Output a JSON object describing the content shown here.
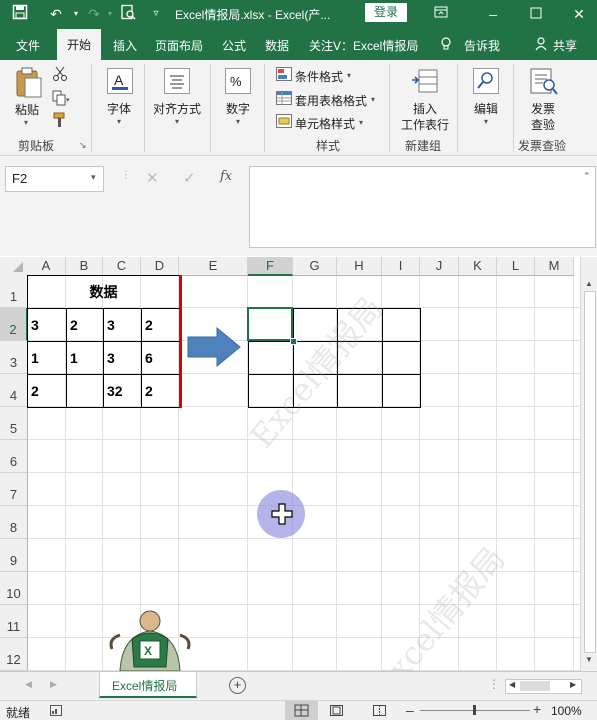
{
  "titlebar": {
    "title": "Excel情报局.xlsx  -  Excel(产...",
    "login_label": "登录"
  },
  "tabs": [
    {
      "label": "文件"
    },
    {
      "label": "开始"
    },
    {
      "label": "插入"
    },
    {
      "label": "页面布局"
    },
    {
      "label": "公式"
    },
    {
      "label": "数据"
    },
    {
      "label": "关注V：Excel情报局"
    },
    {
      "label": "告诉我"
    },
    {
      "label": "共享"
    }
  ],
  "ribbon": {
    "paste_label": "粘贴",
    "clipboard_group": "剪贴板",
    "font_label": "字体",
    "align_label": "对齐方式",
    "number_label": "数字",
    "cond_format_label": "条件格式",
    "table_format_label": "套用表格格式",
    "cell_style_label": "单元格样式",
    "styles_group": "样式",
    "insert_row_line1": "插入",
    "insert_row_line2": "工作表行",
    "newgroup_label": "新建组",
    "edit_label": "编辑",
    "invoice_line1": "发票",
    "invoice_line2": "查验",
    "invoice_group": "发票查验"
  },
  "formula_bar": {
    "name_box": "F2",
    "fx_symbol": "fx",
    "formula_value": ""
  },
  "columns": [
    "A",
    "B",
    "C",
    "D",
    "E",
    "F",
    "G",
    "H",
    "I",
    "J",
    "K",
    "L",
    "M"
  ],
  "rows": [
    "1",
    "2",
    "3",
    "4",
    "5",
    "6",
    "7",
    "8",
    "9",
    "10",
    "11",
    "12"
  ],
  "table": {
    "header": "数据",
    "values": [
      [
        "3",
        "2",
        "3",
        "2"
      ],
      [
        "1",
        "1",
        "3",
        "6"
      ],
      [
        "2",
        "",
        "32",
        "2"
      ]
    ]
  },
  "watermark_text": "Excel情报局",
  "sheet_tab": {
    "label": "Excel情报局"
  },
  "status": {
    "ready": "就绪",
    "zoom": "100%"
  },
  "colors": {
    "excel_green": "#217346",
    "arrow_blue": "#4f81bd",
    "red_line": "#e00000",
    "cursor_halo": "#9a9ae0"
  }
}
